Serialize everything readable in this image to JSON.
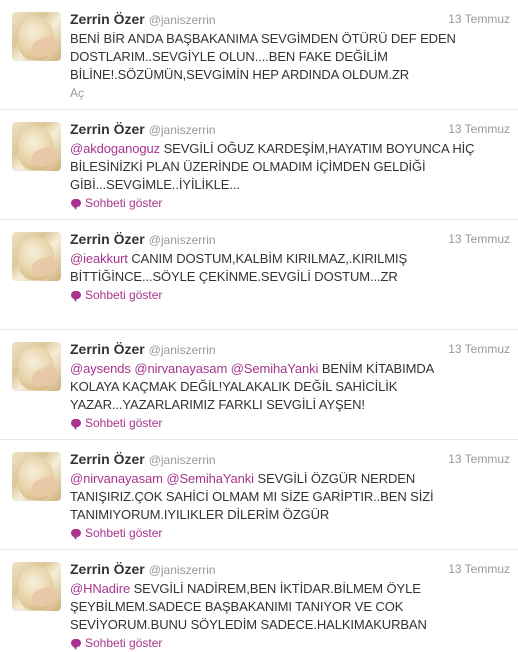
{
  "tweets": [
    {
      "name": "Zerrin Özer",
      "handle": "@janiszerrin",
      "date": "13 Temmuz",
      "lines": [
        [
          {
            "t": "BENİ BİR ANDA BAŞBAKANIMA SEVGİMDEN ÖTÜRÜ DEF EDEN"
          }
        ],
        [
          {
            "t": "DOSTLARIM..SEVGİYLE OLUN....BEN FAKE DEĞİLİM"
          }
        ],
        [
          {
            "t": "BİLİNE!.SÖZÜMÜN,SEVGİMİN HEP ARDINDA OLDUM.ZR"
          }
        ]
      ],
      "action": "Aç",
      "action_type": "expand"
    },
    {
      "name": "Zerrin Özer",
      "handle": "@janiszerrin",
      "date": "13 Temmuz",
      "lines": [
        [
          {
            "t": "@akdoganoguz",
            "m": true
          },
          {
            "t": " SEVGİLİ OĞUZ KARDEŞİM,HAYATIM BOYUNCA HİÇ"
          }
        ],
        [
          {
            "t": "BİLESİNİZKİ PLAN ÜZERİNDE OLMADIM İÇİMDEN GELDİĞİ"
          }
        ],
        [
          {
            "t": "GİBİ...SEVGİMLE..İYİLİKLE..."
          }
        ]
      ],
      "action": "Sohbeti göster",
      "action_type": "conversation"
    },
    {
      "name": "Zerrin Özer",
      "handle": "@janiszerrin",
      "date": "13 Temmuz",
      "lines": [
        [
          {
            "t": "@ieakkurt",
            "m": true
          },
          {
            "t": " CANIM DOSTUM,KALBİM KIRILMAZ,.KIRILMIŞ"
          }
        ],
        [
          {
            "t": "BİTTİĞİNCE...SÖYLE ÇEKİNME.SEVGİLİ DOSTUM...ZR"
          }
        ]
      ],
      "action": "Sohbeti göster",
      "action_type": "conversation"
    },
    {
      "name": "Zerrin Özer",
      "handle": "@janiszerrin",
      "date": "13 Temmuz",
      "lines": [
        [
          {
            "t": "@aysends",
            "m": true
          },
          {
            "t": " "
          },
          {
            "t": "@nirvanayasam",
            "m": true
          },
          {
            "t": " "
          },
          {
            "t": "@SemihaYanki",
            "m": true
          },
          {
            "t": " BENİM KİTABIMDA"
          }
        ],
        [
          {
            "t": "KOLAYA KAÇMAK DEĞİL!YALAKALIK DEĞİL SAHİCİLİK"
          }
        ],
        [
          {
            "t": "YAZAR...YAZARLARIMIZ FARKLI SEVGİLİ AYŞEN!"
          }
        ]
      ],
      "action": "Sohbeti göster",
      "action_type": "conversation"
    },
    {
      "name": "Zerrin Özer",
      "handle": "@janiszerrin",
      "date": "13 Temmuz",
      "lines": [
        [
          {
            "t": "@nirvanayasam",
            "m": true
          },
          {
            "t": " "
          },
          {
            "t": "@SemihaYanki",
            "m": true
          },
          {
            "t": " SEVGİLİ ÖZGÜR NERDEN"
          }
        ],
        [
          {
            "t": "TANIŞIRIZ.ÇOK SAHİCİ OLMAM MI SİZE GARİPTIR..BEN SİZİ"
          }
        ],
        [
          {
            "t": "TANIMIYORUM.IYILIKLER DİLERİM ÖZGÜR"
          }
        ]
      ],
      "action": "Sohbeti göster",
      "action_type": "conversation"
    },
    {
      "name": "Zerrin Özer",
      "handle": "@janiszerrin",
      "date": "13 Temmuz",
      "lines": [
        [
          {
            "t": "@HNadire",
            "m": true
          },
          {
            "t": " SEVGİLİ NADİREM,BEN İKTİDAR.BİLMEM ÖYLE"
          }
        ],
        [
          {
            "t": "ŞEYBİLMEM.SADECE BAŞBAKANIMI TANIYOR VE COK"
          }
        ],
        [
          {
            "t": "SEVİYORUM.BUNU SÖYLEDİM SADECE.HALKIMAKURBAN"
          }
        ]
      ],
      "action": "Sohbeti göster",
      "action_type": "conversation"
    }
  ],
  "colors": {
    "name": "#333333",
    "muted": "#999999",
    "link": "#a8348f",
    "divider": "#e8e8e8"
  },
  "icons": {
    "conversation": "speech-bubble-icon"
  }
}
